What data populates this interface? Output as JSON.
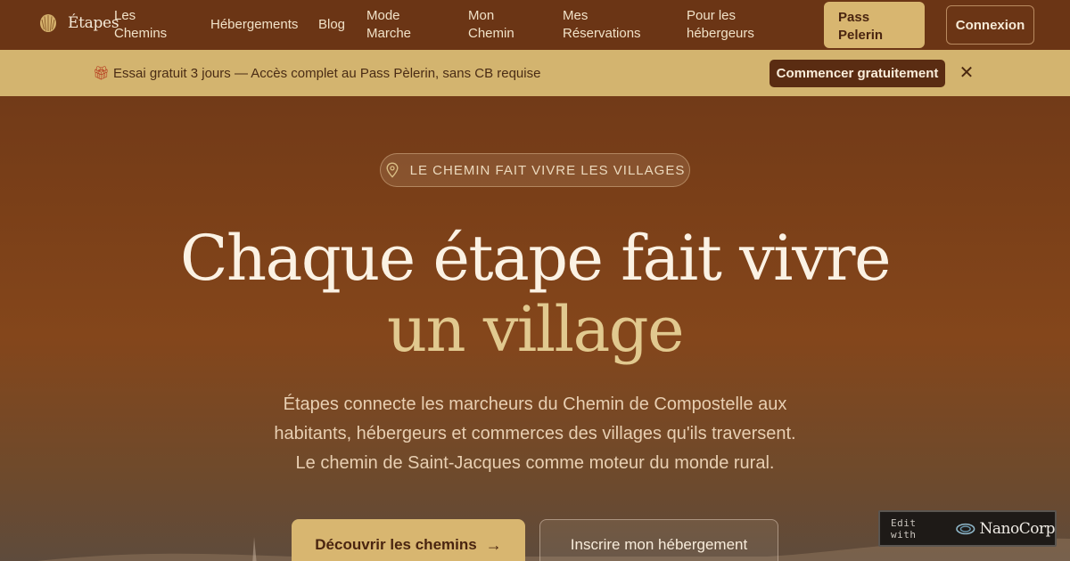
{
  "nav": {
    "brand": "Étapes",
    "links": [
      {
        "line1": "Les",
        "line2": "Chemins"
      },
      {
        "line1": "Hébergements",
        "line2": ""
      },
      {
        "line1": "Blog",
        "line2": ""
      },
      {
        "line1": "Mode",
        "line2": "Marche"
      },
      {
        "line1": "Mon",
        "line2": "Chemin"
      },
      {
        "line1": "Mes",
        "line2": "Réservations"
      },
      {
        "line1": "Pour les",
        "line2": "hébergeurs"
      }
    ],
    "pass_line1": "Pass",
    "pass_line2": "Pelerin",
    "login": "Connexion"
  },
  "banner": {
    "icon": "gift-icon",
    "text": "Essai gratuit 3 jours — Accès complet au Pass Pèlerin, sans CB requise",
    "cta": "Commencer gratuitement",
    "close": "✕"
  },
  "hero": {
    "pill": "LE CHEMIN FAIT VIVRE LES VILLAGES",
    "headline_line1": "Chaque étape fait vivre",
    "headline_line2": "un village",
    "sub_lines": [
      "Étapes connecte les marcheurs du Chemin de Compostelle aux",
      "habitants, hébergeurs et commerces des villages qu'ils traversent.",
      "Le chemin de Saint-Jacques comme moteur du monde rural."
    ],
    "primary_cta": "Découvrir les chemins",
    "secondary_cta": "Inscrire mon hébergement"
  },
  "badge": {
    "edit_label": "Edit with",
    "brand": "NanoCorp"
  },
  "colors": {
    "nav_bg": "#6b3515",
    "banner_bg": "#d3b46f",
    "gold": "#d8b670",
    "headline_accent": "#e1c98f"
  }
}
